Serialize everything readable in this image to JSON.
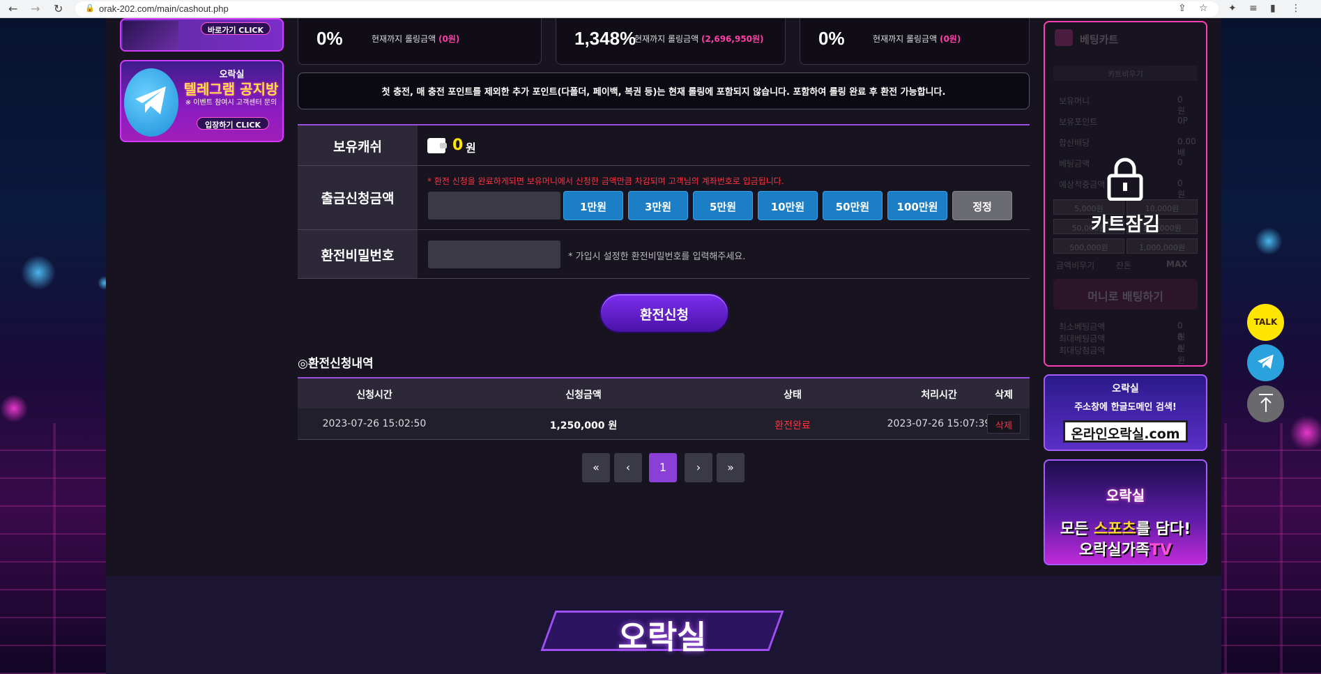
{
  "browser": {
    "url": "orak-202.com/main/cashout.php"
  },
  "left_banners": {
    "banner1_click": "바로가기 CLICK",
    "banner2_brand": "오락실",
    "banner2_title": "텔레그램 공지방",
    "banner2_sub": "※ 이벤트 참여시 고객센터 문의",
    "banner2_click": "입장하기 CLICK"
  },
  "stats": [
    {
      "pct": "0%",
      "label": "현재까지 롤링금액",
      "value": "(0원)"
    },
    {
      "pct": "1,348%",
      "label": "현재까지 롤링금액",
      "value": "(2,696,950원)"
    },
    {
      "pct": "0%",
      "label": "현재까지 롤링금액",
      "value": "(0원)"
    }
  ],
  "notice": "첫 충전, 매 충전 포인트를 제외한 추가 포인트(다폴더, 페이백, 복권 등)는 현재 롤링에 포함되지 않습니다. 포함하여 롤링 완료 후 환전 가능합니다.",
  "form": {
    "cash_label": "보유캐쉬",
    "cash_value": "0",
    "cash_unit": "원",
    "amount_label": "출금신청금액",
    "amount_warning": "* 환전 신청을 완료하게되면 보유머니에서 신청한 금액만큼 차감되며 고객님의 계좌번호로 입금됩니다.",
    "amount_buttons": [
      "1만원",
      "3만원",
      "5만원",
      "10만원",
      "50만원",
      "100만원",
      "정정"
    ],
    "password_label": "환전비밀번호",
    "password_hint": "* 가입시 설정한 환전비밀번호를 입력해주세요.",
    "submit": "환전신청"
  },
  "history": {
    "title": "◎환전신청내역",
    "columns": [
      "신청시간",
      "신청금액",
      "상태",
      "처리시간",
      "삭제"
    ],
    "rows": [
      {
        "requested": "2023-07-26 15:02:50",
        "amount": "1,250,000 원",
        "status": "환전완료",
        "processed": "2023-07-26 15:07:39",
        "delete": "삭제"
      }
    ]
  },
  "pagination": {
    "first": "«",
    "prev": "‹",
    "current": "1",
    "next": "›",
    "last": "»"
  },
  "cart": {
    "title": "베팅카트",
    "clear": "카트비우기",
    "lines": [
      {
        "label": "보유머니",
        "value": "0원"
      },
      {
        "label": "보유포인트",
        "value": "0P"
      },
      {
        "label": "합산배당",
        "value": "0.00배"
      },
      {
        "label": "베팅금액",
        "value": "0"
      },
      {
        "label": "예상적중금액",
        "value": "0원"
      }
    ],
    "amount_grid": [
      "5,000원",
      "10,000원",
      "50,000원",
      "100,000원",
      "500,000원",
      "1,000,000원"
    ],
    "actions": [
      "금액비우기",
      "잔돈",
      "MAX"
    ],
    "bet_button": "머니로 배팅하기",
    "footer_lines": [
      {
        "label": "최소베팅금액",
        "value": "0 원"
      },
      {
        "label": "최대베팅금액",
        "value": "0 원"
      },
      {
        "label": "최대당첨금액",
        "value": "0 원"
      }
    ],
    "lock_text": "카트잠김"
  },
  "right_banners": {
    "banner1_brand": "오락실",
    "banner1_title": "주소창에 한글도메인 검색!",
    "banner1_domain": "온라인오락실.com",
    "banner2_brand": "오락실",
    "banner2_line1a": "모든 ",
    "banner2_line1b": "스포츠",
    "banner2_line1c": "를 담다!",
    "banner2_line2a": "오락실가족",
    "banner2_line2b": "TV"
  },
  "floating": {
    "talk": "TALK"
  },
  "footer": {
    "logo": "오락실"
  },
  "colors": {
    "accent_purple": "#8a3fd6",
    "danger": "#ff3340",
    "highlight_yellow": "#ffe600",
    "button_blue": "#1c7ec4",
    "pink_value": "#ff3fa8"
  }
}
